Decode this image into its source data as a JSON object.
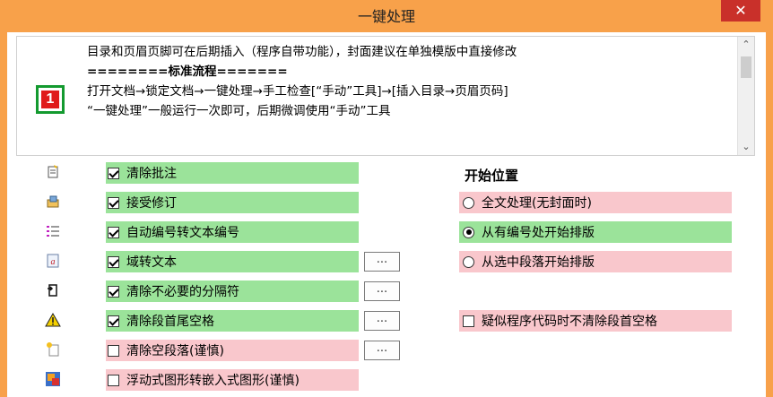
{
  "window": {
    "title": "一键处理",
    "close_label": "✕"
  },
  "notice": {
    "icon_label": "1",
    "lines": [
      "目录和页眉页脚可在后期插入（程序自带功能），封面建议在单独模版中直接修改",
      "========标准流程=======",
      "打开文档→锁定文档→一键处理→手工检查[“手动”工具]→[插入目录→页眉页码]",
      "“一键处理”一般运行一次即可，后期微调使用“手动”工具"
    ],
    "scroll_up": "⌃",
    "scroll_down": "⌄"
  },
  "options": [
    {
      "label": "清除批注",
      "checked": true,
      "color": "green",
      "icon": "comment-icon",
      "has_more": false
    },
    {
      "label": "接受修订",
      "checked": true,
      "color": "green",
      "icon": "accept-revision-icon",
      "has_more": false
    },
    {
      "label": "自动编号转文本编号",
      "checked": true,
      "color": "green",
      "icon": "numbered-list-icon",
      "has_more": false
    },
    {
      "label": "域转文本",
      "checked": true,
      "color": "green",
      "icon": "field-icon",
      "has_more": true
    },
    {
      "label": "清除不必要的分隔符",
      "checked": true,
      "color": "green",
      "icon": "separator-icon",
      "has_more": true
    },
    {
      "label": "清除段首尾空格",
      "checked": true,
      "color": "green",
      "icon": "warning-icon",
      "has_more": true
    },
    {
      "label": "清除空段落(谨慎)",
      "checked": false,
      "color": "pink",
      "icon": "empty-paragraph-icon",
      "has_more": true
    },
    {
      "label": "浮动式图形转嵌入式图形(谨慎)",
      "checked": false,
      "color": "pink",
      "icon": "floating-shape-icon",
      "has_more": false
    }
  ],
  "more_button_label": "...",
  "start_position": {
    "title": "开始位置",
    "choices": [
      {
        "label": "全文处理(无封面时)",
        "selected": false,
        "color": "pink"
      },
      {
        "label": "从有编号处开始排版",
        "selected": true,
        "color": "green"
      },
      {
        "label": "从选中段落开始排版",
        "selected": false,
        "color": "pink"
      }
    ]
  },
  "code_option": {
    "label": "疑似程序代码时不清除段首空格",
    "checked": false,
    "color": "pink"
  },
  "colors": {
    "frame": "#f8a14a",
    "close": "#c9302a",
    "green": "#9be39a",
    "pink": "#f9c7cc",
    "logo_border": "#139a2f",
    "logo_fill": "#e01b1b"
  }
}
